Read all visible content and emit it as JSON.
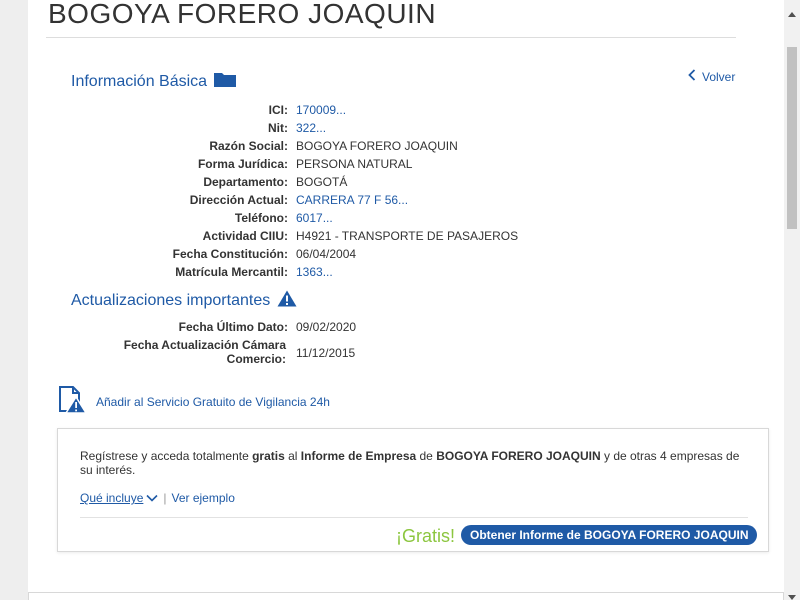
{
  "company": {
    "title": "BOGOYA FORERO JOAQUIN"
  },
  "basic": {
    "title": "Información Básica",
    "back_label": "Volver",
    "rows": [
      {
        "label": "ICI:",
        "value": "170009...",
        "link": true
      },
      {
        "label": "Nit:",
        "value": "322...",
        "link": true
      },
      {
        "label": "Razón Social:",
        "value": "BOGOYA FORERO JOAQUIN",
        "link": false
      },
      {
        "label": "Forma Jurídica:",
        "value": "PERSONA NATURAL",
        "link": false
      },
      {
        "label": "Departamento:",
        "value": "BOGOTÁ",
        "link": false
      },
      {
        "label": "Dirección Actual:",
        "value": "CARRERA 77 F 56...",
        "link": true
      },
      {
        "label": "Teléfono:",
        "value": "6017...",
        "link": true
      },
      {
        "label": "Actividad CIIU:",
        "value": "H4921 - TRANSPORTE DE PASAJEROS",
        "link": false
      },
      {
        "label": "Fecha Constitución:",
        "value": "06/04/2004",
        "link": false
      },
      {
        "label": "Matrícula Mercantil:",
        "value": "1363...",
        "link": true
      }
    ]
  },
  "updates": {
    "title": "Actualizaciones importantes",
    "last_data_label": "Fecha Último Dato:",
    "last_data_value": "09/02/2020",
    "chamber_label_1": "Fecha Actualización Cámara",
    "chamber_label_2": "Comercio:",
    "chamber_value": "11/12/2015"
  },
  "vigilancia": {
    "label": "Añadir al Servicio Gratuito de Vigilancia 24h"
  },
  "promo": {
    "text_1": "Regístrese y acceda totalmente ",
    "text_gratis": "gratis",
    "text_2": " al ",
    "text_informe": "Informe de Empresa",
    "text_3": " de ",
    "text_company": "BOGOYA FORERO JOAQUIN",
    "text_4": " y de otras 4 empresas de su interés.",
    "includes_label": "Qué incluye",
    "separator": "|",
    "example_label": "Ver ejemplo",
    "free_label": "¡Gratis!",
    "cta_label": "Obtener Informe de BOGOYA FORERO JOAQUIN"
  },
  "colors": {
    "link": "#1f5aa6",
    "free": "#8cc63f",
    "cta_bg": "#1f5aa6"
  }
}
